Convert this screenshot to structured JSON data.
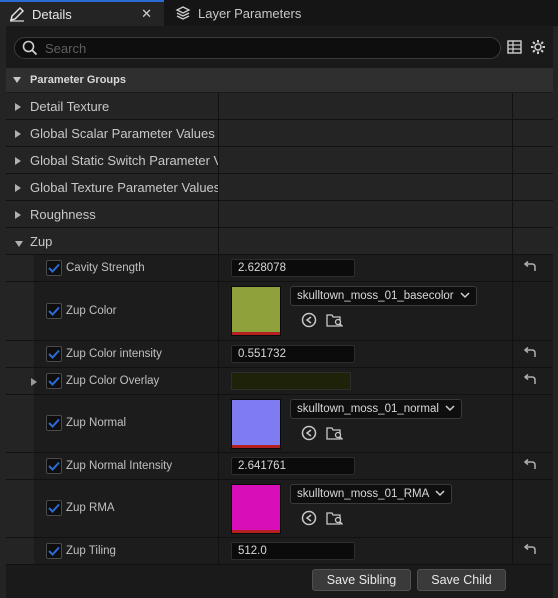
{
  "tabs": [
    {
      "label": "Details",
      "icon": "pencil-icon",
      "active": true
    },
    {
      "label": "Layer Parameters",
      "icon": "layers-icon",
      "active": false
    }
  ],
  "search": {
    "placeholder": "Search"
  },
  "parameter_groups_label": "Parameter Groups",
  "groups": [
    {
      "label": "Detail Texture",
      "expanded": false
    },
    {
      "label": "Global Scalar Parameter Values",
      "expanded": false
    },
    {
      "label": "Global Static Switch Parameter Values",
      "expanded": false
    },
    {
      "label": "Global Texture Parameter Values",
      "expanded": false
    },
    {
      "label": "Roughness",
      "expanded": false
    },
    {
      "label": "Zup",
      "expanded": true
    }
  ],
  "properties": {
    "cavity_strength": {
      "label": "Cavity Strength",
      "value": "2.628078"
    },
    "zup_color": {
      "label": "Zup Color",
      "asset": "skulltown_moss_01_basecolor",
      "swatch": "#8fa13a"
    },
    "zup_color_intensity": {
      "label": "Zup Color intensity",
      "value": "0.551732"
    },
    "zup_color_overlay": {
      "label": "Zup Color Overlay",
      "color": "#1e2208"
    },
    "zup_normal": {
      "label": "Zup Normal",
      "asset": "skulltown_moss_01_normal",
      "swatch": "#7f7cf2"
    },
    "zup_normal_intensity": {
      "label": "Zup Normal Intensity",
      "value": "2.641761"
    },
    "zup_rma": {
      "label": "Zup RMA",
      "asset": "skulltown_moss_01_RMA",
      "swatch": "#d80fb8"
    },
    "zup_tiling": {
      "label": "Zup Tiling",
      "value": "512.0"
    }
  },
  "buttons": {
    "save_sibling": "Save Sibling",
    "save_child": "Save Child"
  },
  "colors": {
    "accent": "#2b6bd6",
    "checkbox_check": "#2b6bd6"
  }
}
